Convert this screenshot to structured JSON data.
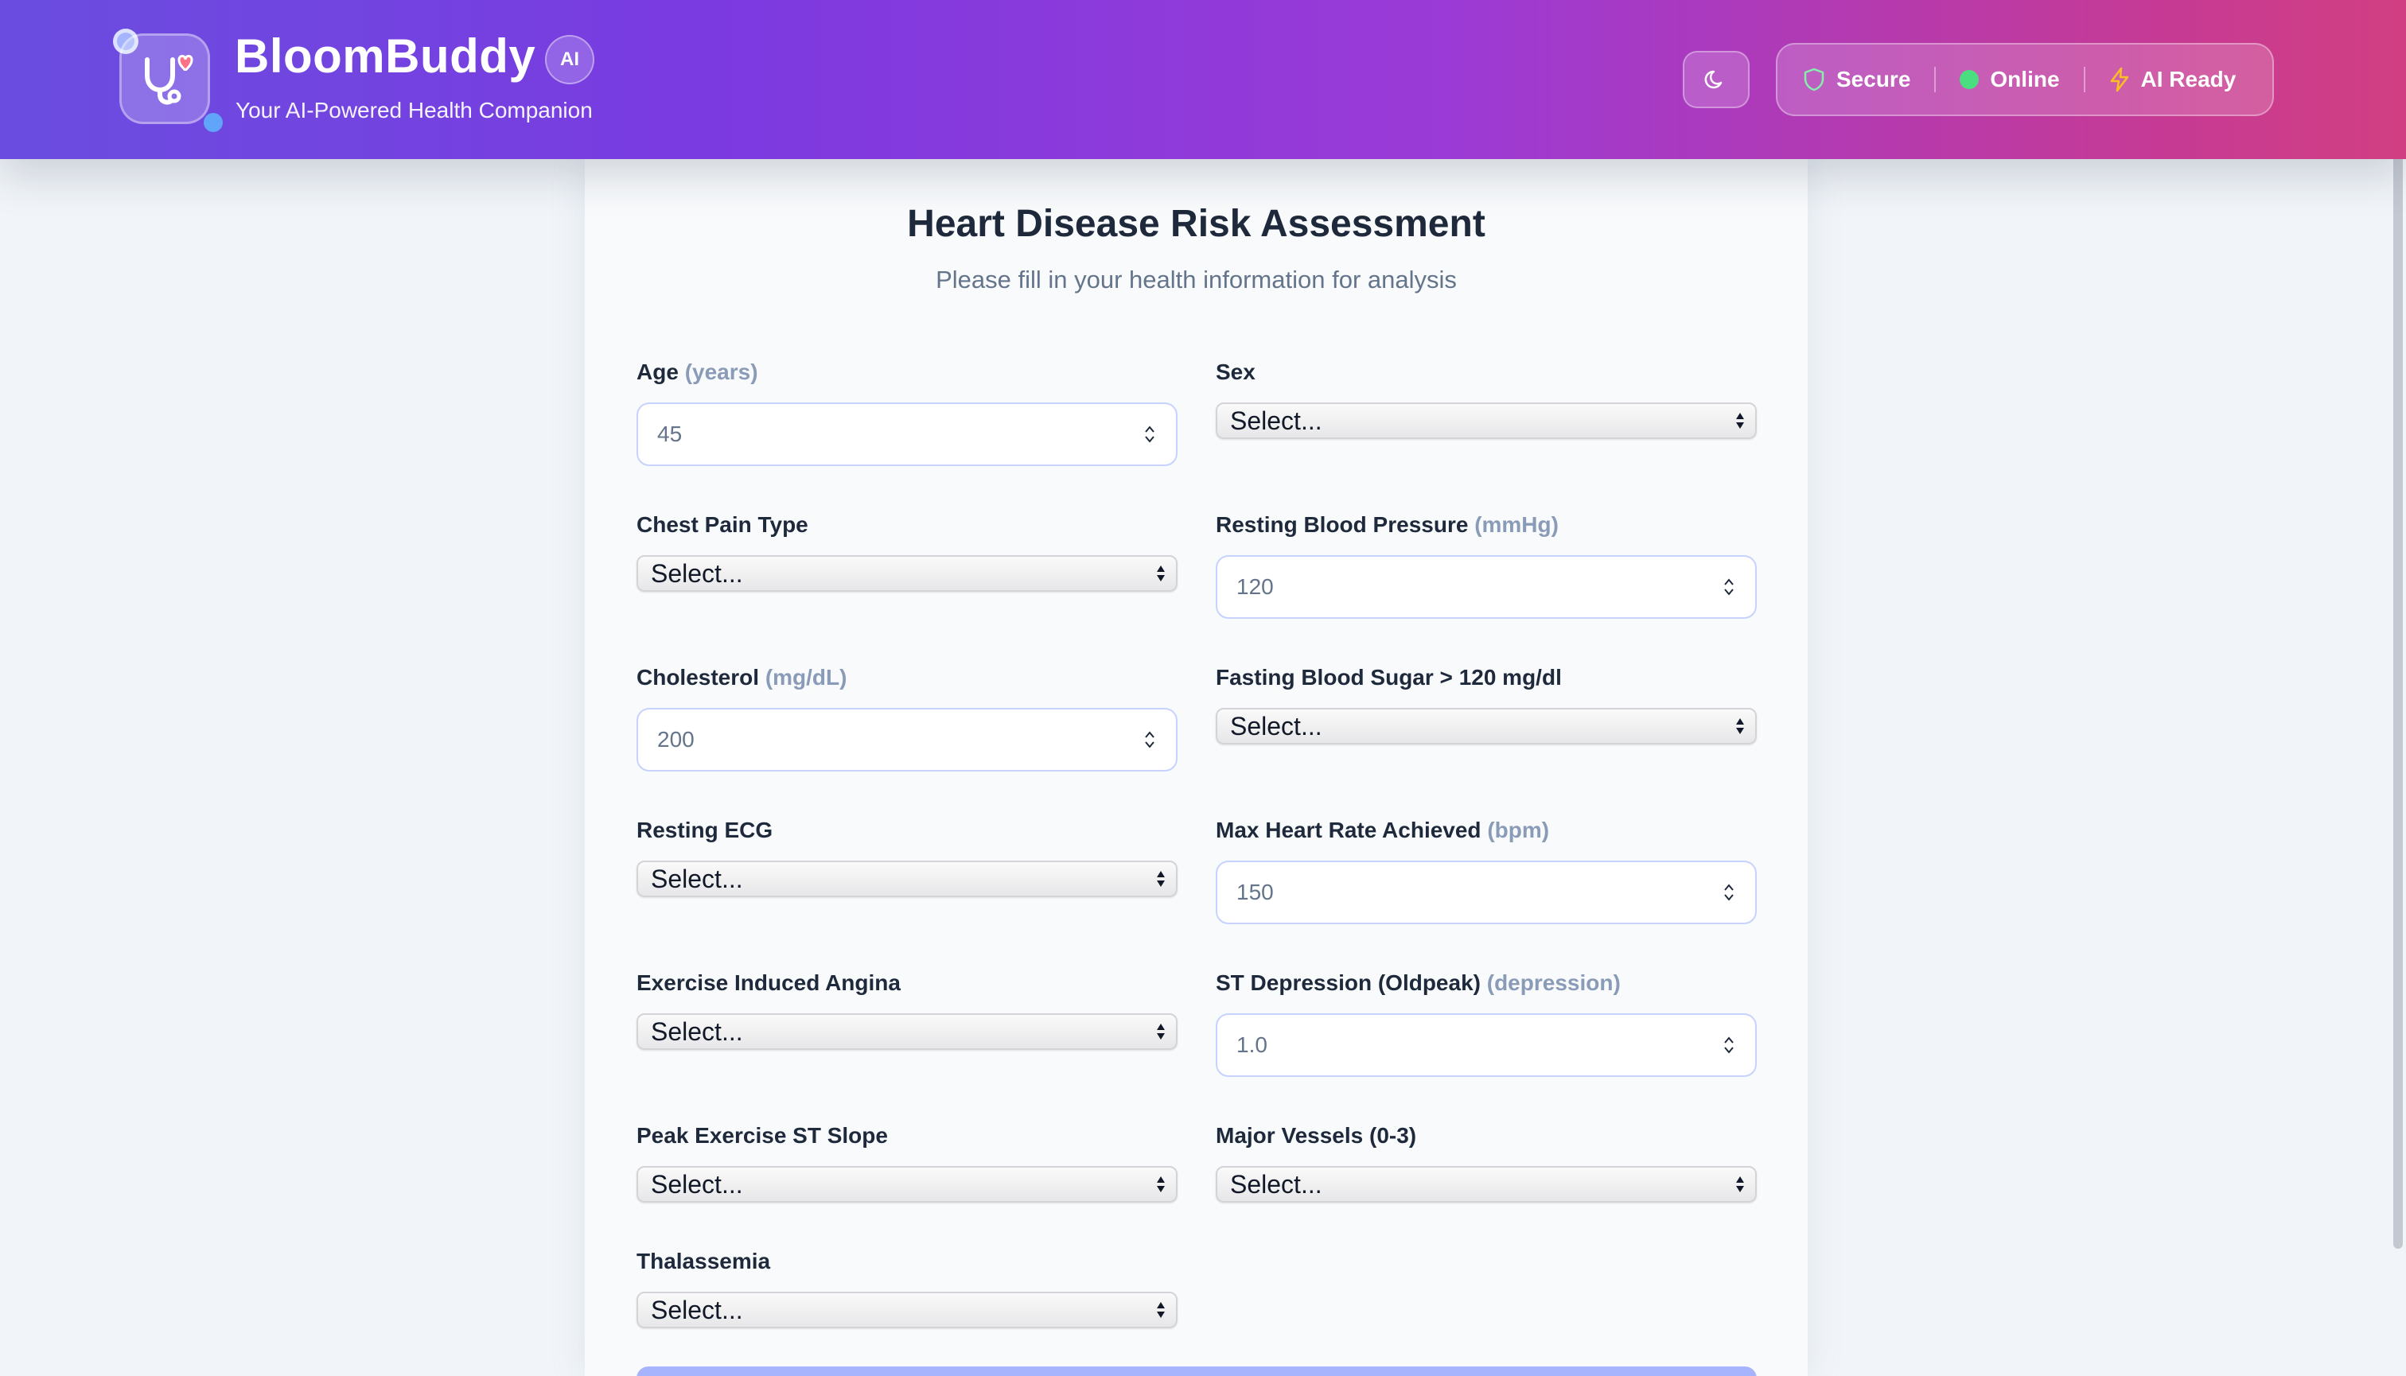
{
  "app": {
    "name": "BloomBuddy",
    "ai_badge": "AI",
    "tagline": "Your AI-Powered Health Companion"
  },
  "status": {
    "secure": "Secure",
    "online": "Online",
    "ai_ready": "AI Ready"
  },
  "form": {
    "title": "Heart Disease Risk Assessment",
    "subtitle": "Please fill in your health information for analysis",
    "fields": {
      "age": {
        "label": "Age",
        "unit": "(years)",
        "placeholder": "45"
      },
      "sex": {
        "label": "Sex",
        "value": "Select..."
      },
      "chest_pain": {
        "label": "Chest Pain Type",
        "value": "Select..."
      },
      "resting_bp": {
        "label": "Resting Blood Pressure",
        "unit": "(mmHg)",
        "placeholder": "120"
      },
      "cholesterol": {
        "label": "Cholesterol",
        "unit": "(mg/dL)",
        "placeholder": "200"
      },
      "fbs": {
        "label": "Fasting Blood Sugar > 120 mg/dl",
        "value": "Select..."
      },
      "resting_ecg": {
        "label": "Resting ECG",
        "value": "Select..."
      },
      "max_hr": {
        "label": "Max Heart Rate Achieved",
        "unit": "(bpm)",
        "placeholder": "150"
      },
      "angina": {
        "label": "Exercise Induced Angina",
        "value": "Select..."
      },
      "oldpeak": {
        "label": "ST Depression (Oldpeak)",
        "unit": "(depression)",
        "placeholder": "1.0"
      },
      "st_slope": {
        "label": "Peak Exercise ST Slope",
        "value": "Select..."
      },
      "vessels": {
        "label": "Major Vessels (0-3)",
        "value": "Select..."
      },
      "thal": {
        "label": "Thalassemia",
        "value": "Select..."
      }
    }
  },
  "icons": {
    "logo": "stethoscope-heart-icon",
    "theme": "moon-icon",
    "secure": "shield-icon",
    "ai_ready": "lightning-icon"
  },
  "colors": {
    "header_gradient_start": "#6a4de0",
    "header_gradient_end": "#d13f82",
    "online": "#4ade80",
    "input_border": "#c7d2fe",
    "unit_text": "#8a9bb8"
  }
}
